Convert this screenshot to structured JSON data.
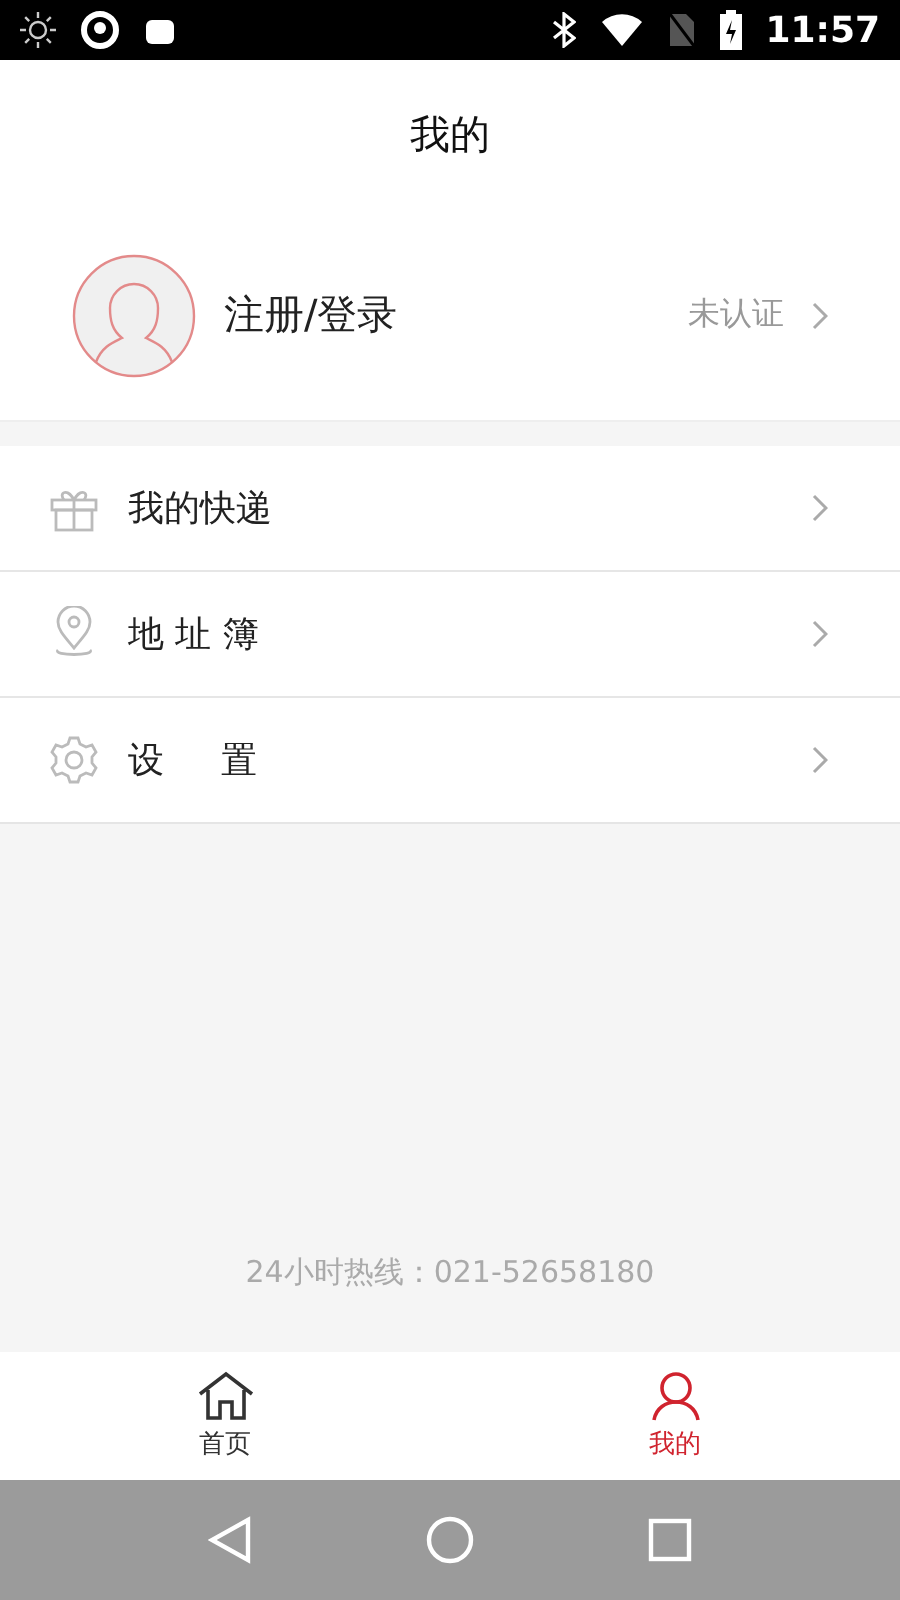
{
  "status_bar": {
    "time": "11:57"
  },
  "header": {
    "title": "我的"
  },
  "profile": {
    "name": "注册/登录",
    "status": "未认证"
  },
  "menu": [
    {
      "label": "我的快递"
    },
    {
      "label": "地 址 簿"
    },
    {
      "label": "设     置"
    }
  ],
  "hotline": "24小时热线：021-52658180",
  "tabs": [
    {
      "label": "首页",
      "selected": false
    },
    {
      "label": "我的",
      "selected": true
    }
  ]
}
